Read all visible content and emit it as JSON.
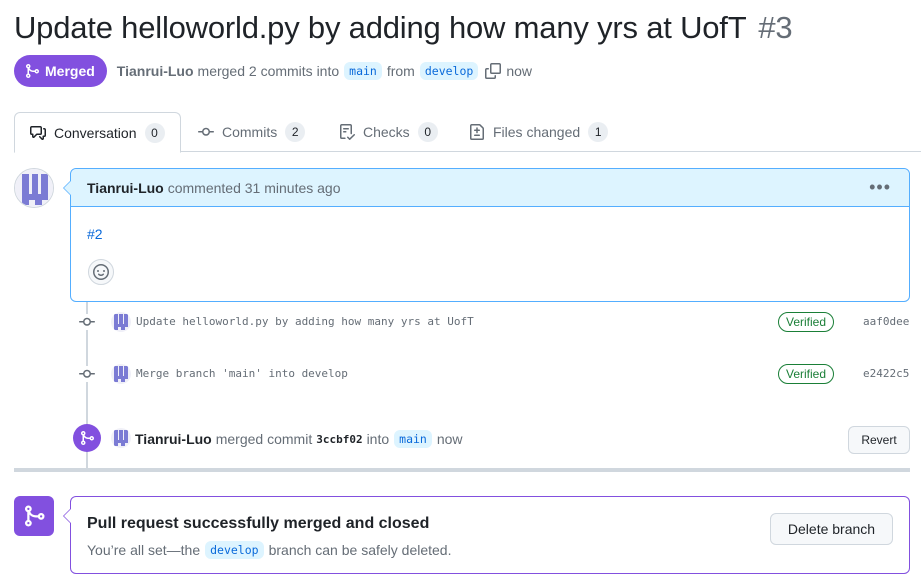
{
  "pr": {
    "title": "Update helloworld.py by adding how many yrs at UofT",
    "number": "#3",
    "state_label": "Merged",
    "author": "Tianrui-Luo",
    "summary_middle": "merged 2 commits into",
    "base_branch": "main",
    "from_word": "from",
    "head_branch": "develop",
    "time": "now"
  },
  "tabs": [
    {
      "label": "Conversation",
      "count": "0",
      "icon": "comment-discussion-icon"
    },
    {
      "label": "Commits",
      "count": "2",
      "icon": "commit-icon"
    },
    {
      "label": "Checks",
      "count": "0",
      "icon": "checklist-icon"
    },
    {
      "label": "Files changed",
      "count": "1",
      "icon": "file-diff-icon"
    }
  ],
  "comment": {
    "author": "Tianrui-Luo",
    "action": "commented 31 minutes ago",
    "body_link": "#2",
    "menu_glyph": "•••"
  },
  "commits": [
    {
      "message": "Update helloworld.py by adding how many yrs at UofT",
      "badge": "Verified",
      "sha": "aaf0dee"
    },
    {
      "message": "Merge branch 'main' into develop",
      "badge": "Verified",
      "sha": "e2422c5"
    }
  ],
  "merge_event": {
    "author": "Tianrui-Luo",
    "action": "merged commit",
    "sha": "3ccbf02",
    "into_word": "into",
    "branch": "main",
    "time": "now",
    "revert_label": "Revert"
  },
  "merge_box": {
    "title": "Pull request successfully merged and closed",
    "sub_prefix": "You’re all set—the",
    "branch": "develop",
    "sub_suffix": "branch can be safely deleted.",
    "delete_label": "Delete branch"
  },
  "colors": {
    "accent_purple": "#8250df",
    "link_blue": "#0969da",
    "verified_green": "#1a7f37",
    "header_blue_bg": "#ddf4ff"
  }
}
